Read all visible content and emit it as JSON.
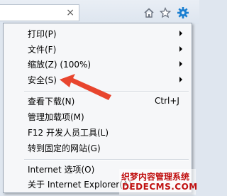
{
  "toolbar": {
    "address_close": "×",
    "icons": [
      "home-icon",
      "favorites-star-icon",
      "tools-gear-icon"
    ]
  },
  "menu": {
    "items": [
      {
        "label": "打印(P)",
        "submenu": true
      },
      {
        "label": "文件(F)",
        "submenu": true
      },
      {
        "label": "缩放(Z) (100%)",
        "submenu": true
      },
      {
        "label": "安全(S)",
        "submenu": true
      },
      {
        "label": "查看下载(N)",
        "shortcut": "Ctrl+J"
      },
      {
        "label": "管理加载项(M)"
      },
      {
        "label": "F12 开发人员工具(L)"
      },
      {
        "label": "转到固定的网站(G)"
      },
      {
        "label": "Internet 选项(O)"
      },
      {
        "label": "关于 Internet Explorer(A)"
      }
    ]
  },
  "watermark": {
    "line1": "织梦内容管理系统",
    "line2": "DEDECMS.COM"
  },
  "colors": {
    "arrow": "#e8452e",
    "gear": "#1a7fd1",
    "watermark": "#c01010"
  }
}
